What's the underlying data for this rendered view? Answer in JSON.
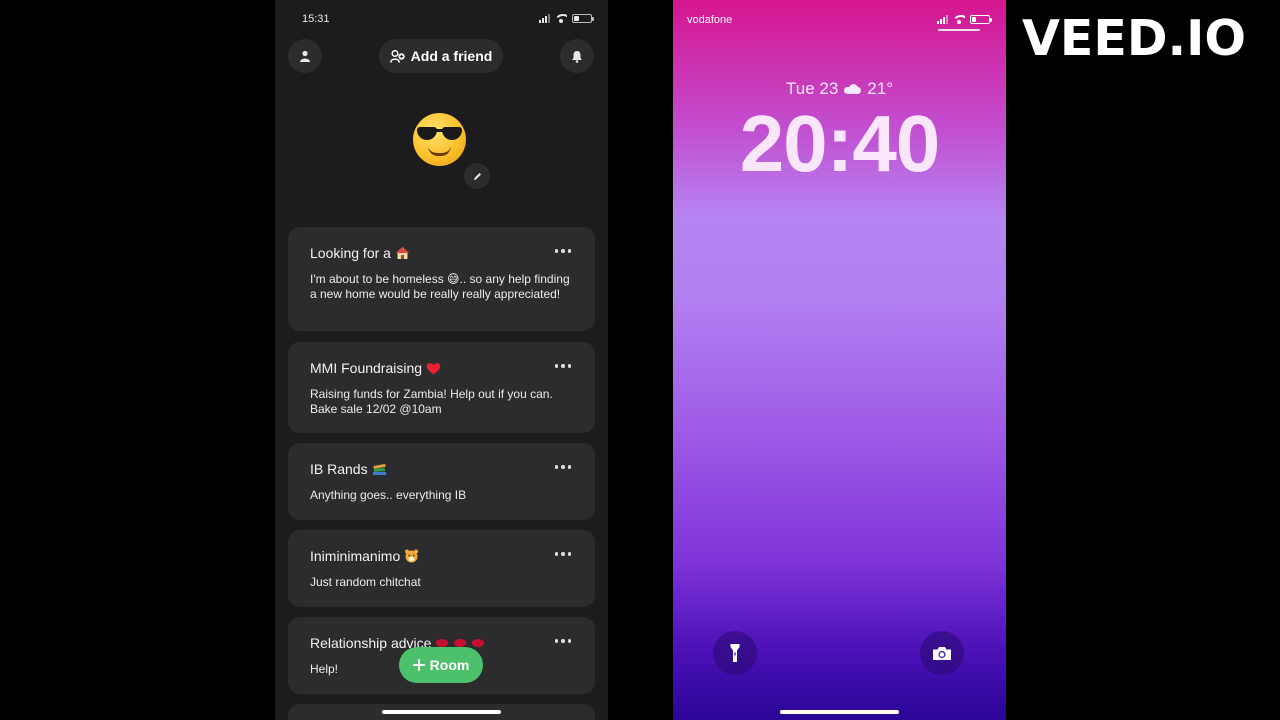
{
  "left_phone": {
    "status_time": "15:31",
    "header": {
      "add_friend_label": "Add a friend"
    },
    "rooms": [
      {
        "title": "Looking for a",
        "desc": "I'm about to be homeless 😅.. so any help finding a new home would be really really appreciated!"
      },
      {
        "title": "MMI Foundraising",
        "desc": "Raising funds for Zambia! Help out if you can. Bake sale 12/02 @10am"
      },
      {
        "title": "IB Rands",
        "desc": "Anything goes.. everything IB"
      },
      {
        "title": "Iniminimanimo",
        "desc": "Just random chitchat"
      },
      {
        "title": "Relationship advice",
        "desc": "Help!"
      }
    ],
    "room_button_label": "Room"
  },
  "right_phone": {
    "carrier": "vodafone",
    "date": "Tue 23",
    "temperature": "21°",
    "time": "20:40"
  },
  "watermark": "VEED.IO",
  "colors": {
    "app_bg": "#1c1c1e",
    "card_bg": "#2c2c2e",
    "accent_green": "#4cc06a"
  }
}
